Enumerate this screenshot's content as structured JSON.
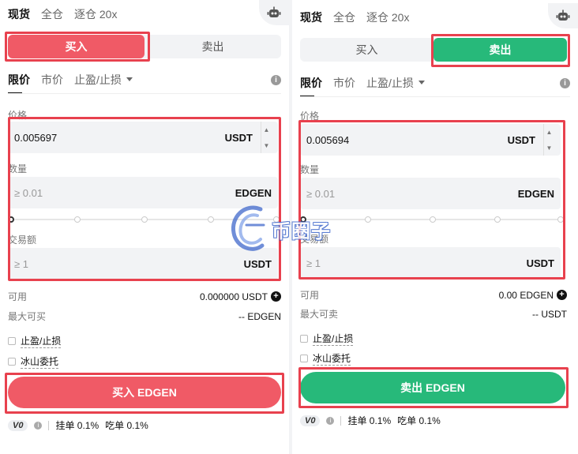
{
  "buy_panel": {
    "mode_tabs": [
      "现货",
      "全仓",
      "逐仓 20x"
    ],
    "side_buy": "买入",
    "side_sell": "卖出",
    "order_types": {
      "limit": "限价",
      "market": "市价",
      "tp_sl": "止盈/止损"
    },
    "price_label": "价格",
    "price_value": "0.005697",
    "price_unit": "USDT",
    "qty_label": "数量",
    "qty_placeholder": "≥ 0.01",
    "qty_unit": "EDGEN",
    "amount_label": "交易额",
    "amount_placeholder": "≥ 1",
    "amount_unit": "USDT",
    "available_label": "可用",
    "available_value": "0.000000 USDT",
    "max_label": "最大可买",
    "max_value": "-- EDGEN",
    "opt_tp_sl": "止盈/止损",
    "opt_iceberg": "冰山委托",
    "submit": "买入 EDGEN",
    "vip": "V0",
    "maker_fee": "挂单 0.1%",
    "taker_fee": "吃单 0.1%"
  },
  "sell_panel": {
    "mode_tabs": [
      "现货",
      "全仓",
      "逐仓 20x"
    ],
    "side_buy": "买入",
    "side_sell": "卖出",
    "order_types": {
      "limit": "限价",
      "market": "市价",
      "tp_sl": "止盈/止损"
    },
    "price_label": "价格",
    "price_value": "0.005694",
    "price_unit": "USDT",
    "qty_label": "数量",
    "qty_placeholder": "≥ 0.01",
    "qty_unit": "EDGEN",
    "amount_label": "交易额",
    "amount_placeholder": "≥ 1",
    "amount_unit": "USDT",
    "available_label": "可用",
    "available_value": "0.00 EDGEN",
    "max_label": "最大可卖",
    "max_value": "-- USDT",
    "opt_tp_sl": "止盈/止损",
    "opt_iceberg": "冰山委托",
    "submit": "卖出 EDGEN",
    "vip": "V0",
    "maker_fee": "挂单 0.1%",
    "taker_fee": "吃单 0.1%"
  },
  "watermark": "币圈子",
  "colors": {
    "buy": "#f05a66",
    "sell": "#27b97a",
    "highlight": "#e8414e"
  },
  "icons": [
    "robot-icon",
    "info-icon",
    "caret-down-icon",
    "plus-circle-icon",
    "stepper-up-icon",
    "stepper-down-icon"
  ]
}
